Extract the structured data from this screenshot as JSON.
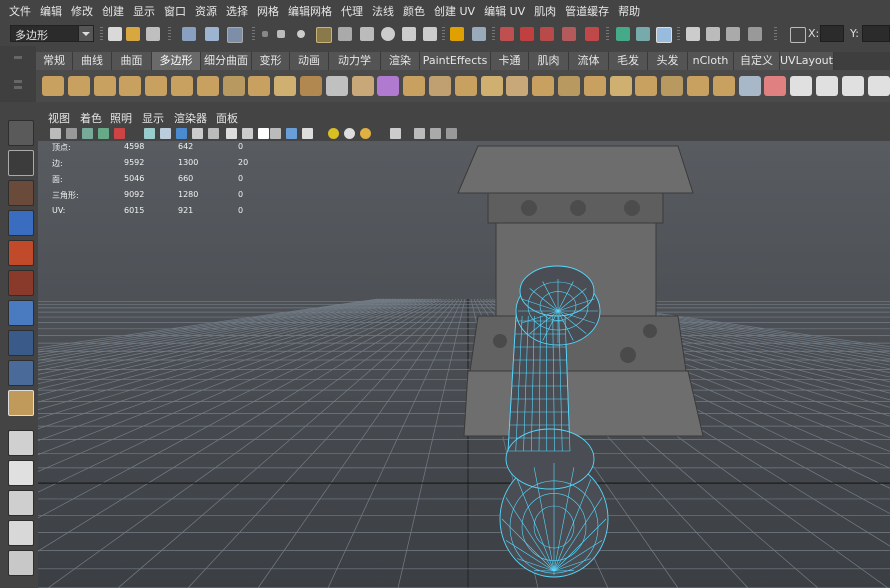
{
  "menubar": {
    "items": [
      "文件",
      "编辑",
      "修改",
      "创建",
      "显示",
      "窗口",
      "资源",
      "选择",
      "网格",
      "编辑网格",
      "代理",
      "法线",
      "颜色",
      "创建 UV",
      "编辑 UV",
      "肌肉",
      "管道缓存",
      "帮助"
    ]
  },
  "statusline": {
    "mode_menu": "多边形",
    "x_label": "X:",
    "y_label": "Y:"
  },
  "shelf": {
    "tabs": [
      "常规",
      "曲线",
      "曲面",
      "多边形",
      "细分曲面",
      "变形",
      "动画",
      "动力学",
      "渲染",
      "PaintEffects",
      "卡通",
      "肌肉",
      "流体",
      "毛发",
      "头发",
      "nCloth",
      "自定义",
      "UVLayout"
    ],
    "active_tab": "多边形"
  },
  "panel": {
    "menu": [
      "视图",
      "着色",
      "照明",
      "显示",
      "渲染器",
      "面板"
    ]
  },
  "hud": {
    "rows": [
      {
        "label": "顶点:",
        "values": [
          "4598",
          "642",
          "0"
        ]
      },
      {
        "label": "边:",
        "values": [
          "9592",
          "1300",
          "20"
        ]
      },
      {
        "label": "面:",
        "values": [
          "5046",
          "660",
          "0"
        ]
      },
      {
        "label": "三角形:",
        "values": [
          "9092",
          "1280",
          "0"
        ]
      },
      {
        "label": "UV:",
        "values": [
          "6015",
          "921",
          "0"
        ]
      }
    ]
  },
  "colors": {
    "ui_bg": "#444444",
    "viewport_bg": "#4d5157",
    "grid_line": "#737c86",
    "grid_center": "#000000",
    "wireframe": "#56d8ff",
    "model_gray": "#6c6c6c"
  }
}
